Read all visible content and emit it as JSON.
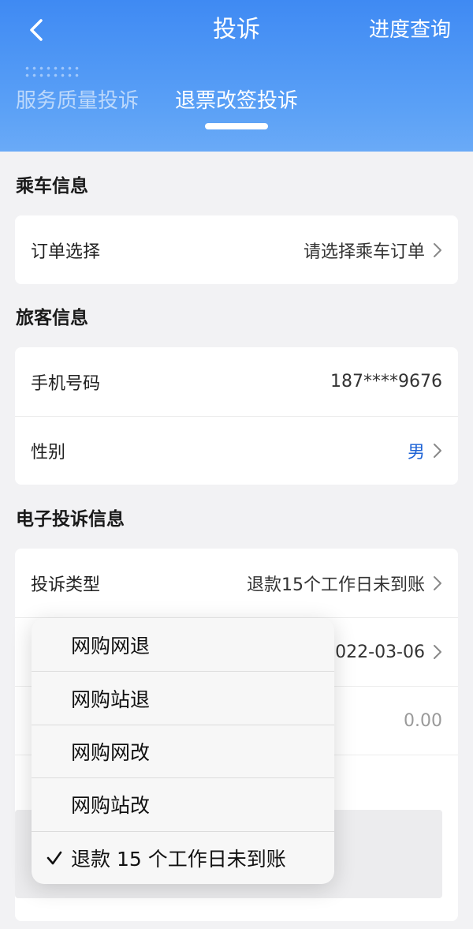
{
  "header": {
    "title": "投诉",
    "progress_link": "进度查询",
    "tabs": [
      {
        "label": "服务质量投诉",
        "active": false
      },
      {
        "label": "退票改签投诉",
        "active": true
      }
    ]
  },
  "sections": {
    "ride_info": {
      "title": "乘车信息",
      "order": {
        "label": "订单选择",
        "value": "请选择乘车订单"
      }
    },
    "passenger_info": {
      "title": "旅客信息",
      "phone": {
        "label": "手机号码",
        "value": "187****9676"
      },
      "gender": {
        "label": "性别",
        "value": "男"
      }
    },
    "complaint_info": {
      "title": "电子投诉信息",
      "type": {
        "label": "投诉类型",
        "value": "退款15个工作日未到账"
      },
      "date": {
        "value": "2022-03-06"
      },
      "amount": {
        "value": "0.00"
      }
    }
  },
  "dropdown": {
    "options": [
      {
        "label": "网购网退",
        "selected": false
      },
      {
        "label": "网购站退",
        "selected": false
      },
      {
        "label": "网购网改",
        "selected": false
      },
      {
        "label": "网购站改",
        "selected": false
      },
      {
        "label": "退款 15 个工作日未到账",
        "selected": true
      }
    ]
  },
  "colors": {
    "header_top": "#3f8af3",
    "header_bottom": "#6aaaf7",
    "accent_blue": "#1e63d6",
    "page_bg": "#f2f2f4"
  },
  "icons": {
    "back": "chevron-left-icon",
    "chevron": "chevron-right-icon",
    "check": "check-icon"
  }
}
